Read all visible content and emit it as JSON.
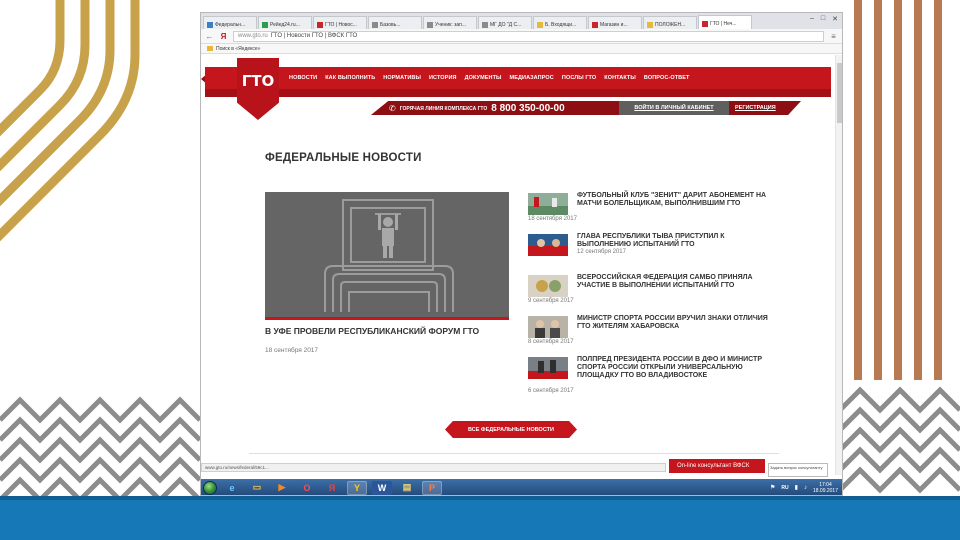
{
  "colors": {
    "brand_red": "#c4161c",
    "dark_red": "#8d0f14",
    "slide_blue": "#1778b8",
    "deco_gold": "#c8a24a",
    "deco_copper": "#b87a52"
  },
  "browser": {
    "tabs": [
      {
        "label": "Федеральн..."
      },
      {
        "label": "Рейед24.ru..."
      },
      {
        "label": "ГТО | Новос..."
      },
      {
        "label": "Базовь..."
      },
      {
        "label": "Ученик: зап..."
      },
      {
        "label": "МГ ДО \"Д С..."
      },
      {
        "label": "Б. Входящи..."
      },
      {
        "label": "Магазин и..."
      },
      {
        "label": "ПОЛОЖЕН..."
      },
      {
        "label": "ГТО | Неч..."
      }
    ],
    "window_controls": {
      "min": "–",
      "max": "□",
      "close": "✕"
    },
    "back": "←",
    "yandex": "Я",
    "url_host": "www.gto.ru",
    "url_title": "ГТО | Новости ГТО | ВФСК ГТО",
    "menu_icon": "≡",
    "bookmark_label": "Поиск в «Яндексе»"
  },
  "site": {
    "logo_text": "ГТО",
    "menu": [
      "НОВОСТИ",
      "КАК ВЫПОЛНИТЬ",
      "НОРМАТИВЫ",
      "ИСТОРИЯ",
      "ДОКУМЕНТЫ",
      "МЕДИАЗАПРОС",
      "ПОСЛЫ ГТО",
      "КОНТАКТЫ",
      "ВОПРОС-ОТВЕТ"
    ],
    "hotline_label": "ГОРЯЧАЯ ЛИНИЯ КОМПЛЕКСА ГТО",
    "hotline_number": "8 800 350-00-00",
    "account_link": "ВОЙТИ В ЛИЧНЫЙ КАБИНЕТ",
    "register_link": "РЕГИСТРАЦИЯ",
    "page_title": "ФЕДЕРАЛЬНЫЕ НОВОСТИ",
    "main_news": {
      "title": "В УФЕ ПРОВЕЛИ РЕСПУБЛИКАНСКИЙ ФОРУМ ГТО",
      "date": "18 сентября 2017"
    },
    "news": [
      {
        "title": "ФУТБОЛЬНЫЙ КЛУБ \"ЗЕНИТ\" ДАРИТ АБОНЕМЕНТ НА МАТЧИ БОЛЕЛЬЩИКАМ, ВЫПОЛНИВШИМ ГТО",
        "date": "18 сентября 2017"
      },
      {
        "title": "ГЛАВА РЕСПУБЛИКИ ТЫВА ПРИСТУПИЛ К ВЫПОЛНЕНИЮ ИСПЫТАНИЙ ГТО",
        "date": "12 сентября 2017"
      },
      {
        "title": "ВСЕРОССИЙСКАЯ ФЕДЕРАЦИЯ САМБО ПРИНЯЛА УЧАСТИЕ В ВЫПОЛНЕНИИ ИСПЫТАНИЙ ГТО",
        "date": "9 сентября 2017"
      },
      {
        "title": "МИНИСТР СПОРТА РОССИИ ВРУЧИЛ ЗНАКИ ОТЛИЧИЯ ГТО ЖИТЕЛЯМ ХАБАРОВСКА",
        "date": "8 сентября 2017"
      },
      {
        "title": "ПОЛПРЕД ПРЕЗИДЕНТА РОССИИ В ДФО И МИНИСТР СПОРТА РОССИИ ОТКРЫЛИ УНИВЕРСАЛЬНУЮ ПЛОЩАДКУ ГТО ВО ВЛАДИВОСТОКЕ",
        "date": "6 сентября 2017"
      }
    ],
    "all_news_button": "ВСЕ ФЕДЕРАЛЬНЫЕ НОВОСТИ",
    "status_url": "www.gto.ru/news/federal/59c1...",
    "chat_label": "On-line консультант ВФСК",
    "chat_popup": "Задать вопрос консультанту"
  },
  "taskbar": {
    "apps": [
      {
        "icon": "ie-icon",
        "glyph": "e"
      },
      {
        "icon": "explorer-icon",
        "glyph": "▭"
      },
      {
        "icon": "media-player-icon",
        "glyph": "▶"
      },
      {
        "icon": "opera-icon",
        "glyph": "O"
      },
      {
        "icon": "yandex-icon",
        "glyph": "Я"
      },
      {
        "icon": "yandex-browser-icon",
        "glyph": "Y"
      },
      {
        "icon": "word-icon",
        "glyph": "W"
      },
      {
        "icon": "folder-icon",
        "glyph": "▤"
      },
      {
        "icon": "presentation-icon",
        "glyph": "P"
      }
    ],
    "lang": "RU",
    "time": "17:04",
    "date": "18.09.2017"
  }
}
